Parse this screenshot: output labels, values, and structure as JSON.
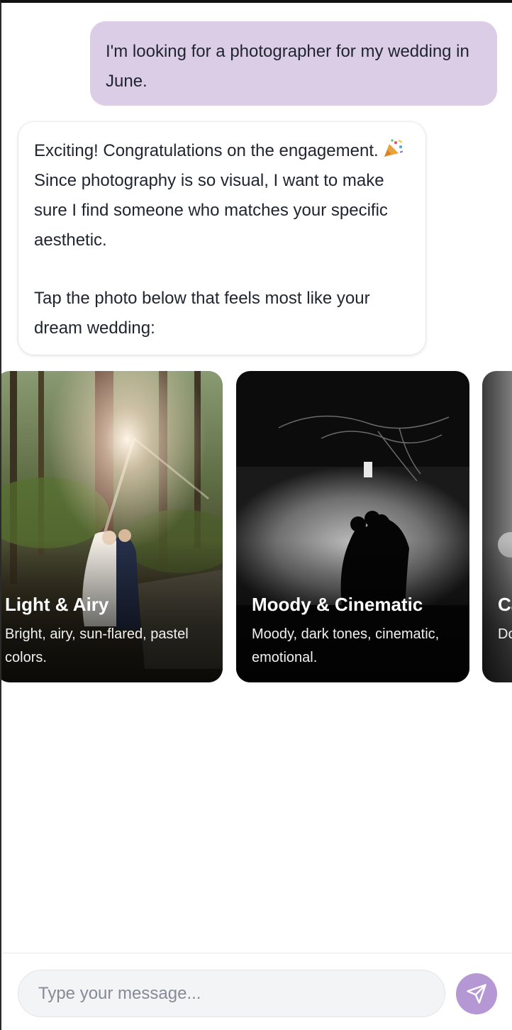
{
  "conversation": {
    "user_message": "I'm looking for a photographer for my wedding in June.",
    "bot_message": {
      "line1_before_emoji": "Exciting! Congratulations on the engagement.",
      "emoji": "party-popper-emoji",
      "line1_after_emoji": " Since photography is so visual, I want to make sure I find someone who matches your specific aesthetic.",
      "line2": "Tap the photo below that feels most like your dream wedding:"
    }
  },
  "style_options": [
    {
      "title": "Light & Airy",
      "description": "Bright, airy, sun-flared, pastel colors."
    },
    {
      "title": "Moody & Cinematic",
      "description": "Moody, dark tones, cinematic, emotional."
    },
    {
      "title": "Ca",
      "description": "Do & v"
    }
  ],
  "composer": {
    "placeholder": "Type your message...",
    "send_icon": "send-icon"
  },
  "colors": {
    "user_bubble": "#dccde7",
    "accent": "#b597d4",
    "text": "#1f2430"
  }
}
